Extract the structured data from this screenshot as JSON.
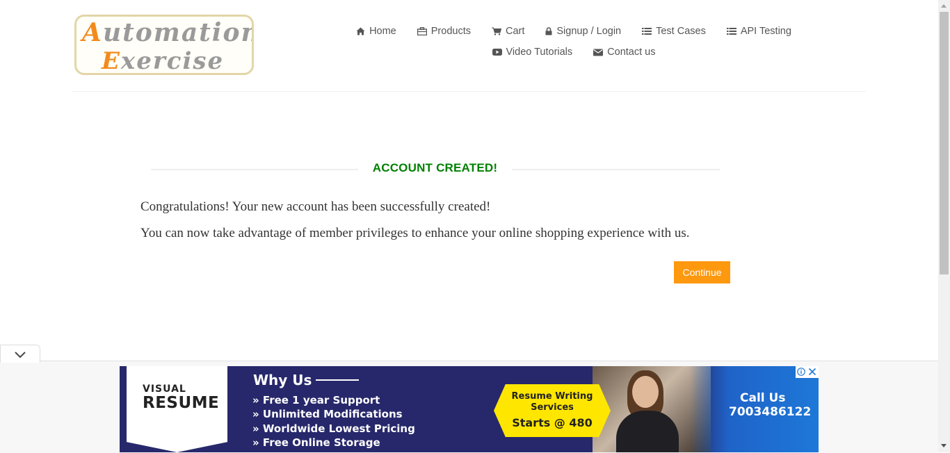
{
  "logo": {
    "text_line1": "Automation",
    "text_line2": "Exercise",
    "accent_color": "#f28b1c"
  },
  "nav": {
    "items": [
      {
        "label": "Home",
        "icon": "home-icon"
      },
      {
        "label": "Products",
        "icon": "briefcase-icon"
      },
      {
        "label": "Cart",
        "icon": "cart-icon"
      },
      {
        "label": "Signup / Login",
        "icon": "lock-icon"
      },
      {
        "label": "Test Cases",
        "icon": "list-icon"
      },
      {
        "label": "API Testing",
        "icon": "list-icon"
      },
      {
        "label": "Video Tutorials",
        "icon": "youtube-play-icon"
      },
      {
        "label": "Contact us",
        "icon": "envelope-icon"
      }
    ]
  },
  "main": {
    "title": "ACCOUNT CREATED!",
    "title_color": "#008000",
    "message1": "Congratulations! Your new account has been successfully created!",
    "message2": "You can now take advantage of member privileges to enhance your online shopping experience with us.",
    "continue_label": "Continue",
    "continue_color": "#fe980f"
  },
  "ad": {
    "brand_line1": "VISUAL",
    "brand_line2": "RESUME",
    "heading": "Why Us",
    "features": [
      "» Free 1 year Support",
      "» Unlimited Modifications",
      "» Worldwide Lowest Pricing",
      "» Free Online Storage"
    ],
    "badge_line1": "Resume Writing Services",
    "badge_line2": "Starts @ 480",
    "cta_line1": "Call Us",
    "cta_line2": "7003486122",
    "icons": [
      "info-icon",
      "close-icon"
    ]
  }
}
